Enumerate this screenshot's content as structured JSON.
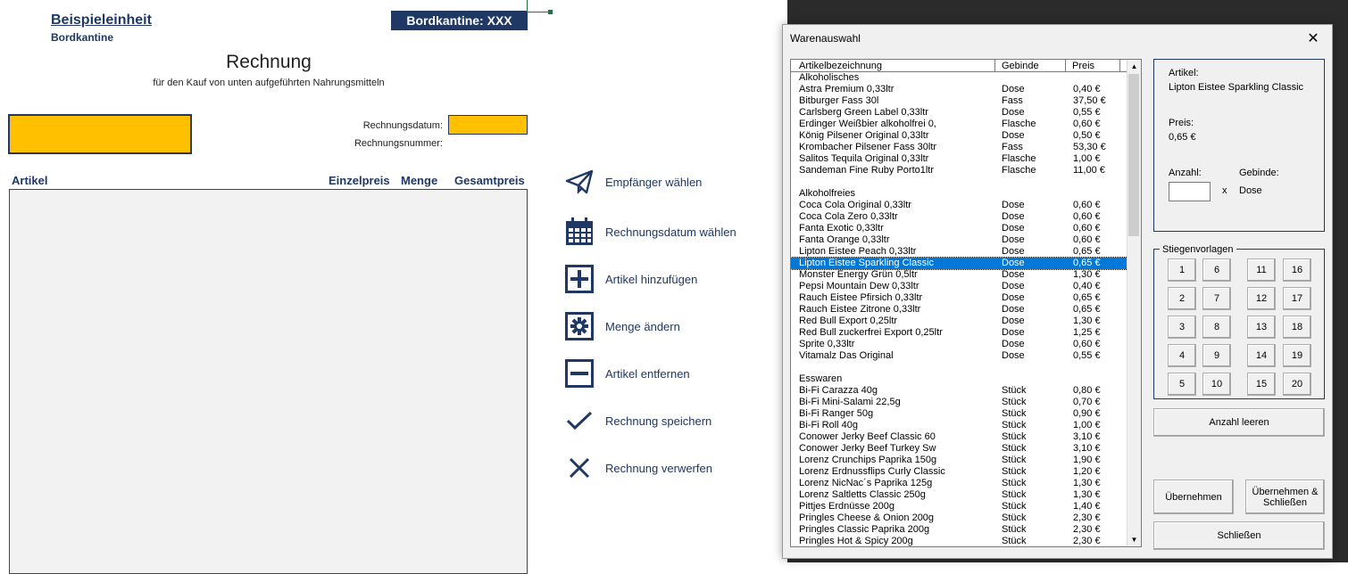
{
  "sheet": {
    "unit_name": "Beispieleinheit",
    "unit_sub": "Bordkantine",
    "kantine_label": "Bordkantine: XXX",
    "title": "Rechnung",
    "subtitle": "für den Kauf von unten aufgeführten Nahrungsmitteln",
    "date_label": "Rechnungsdatum:",
    "number_label": "Rechnungsnummer:",
    "columns": {
      "artikel": "Artikel",
      "einzelpreis": "Einzelpreis",
      "menge": "Menge",
      "gesamtpreis": "Gesamtpreis"
    },
    "highlight_color": "#ffc000",
    "brand_color": "#1f3864"
  },
  "actions": [
    {
      "icon": "paper-plane-icon",
      "label": "Empfänger wählen"
    },
    {
      "icon": "calendar-icon",
      "label": "Rechnungsdatum wählen"
    },
    {
      "icon": "plus-box-icon",
      "label": "Artikel hinzufügen"
    },
    {
      "icon": "gear-box-icon",
      "label": "Menge ändern"
    },
    {
      "icon": "minus-box-icon",
      "label": "Artikel entfernen"
    },
    {
      "icon": "checkmark-icon",
      "label": "Rechnung speichern"
    },
    {
      "icon": "x-mark-icon",
      "label": "Rechnung verwerfen"
    }
  ],
  "dialog": {
    "title": "Warenauswahl",
    "close": "✕",
    "list_headers": {
      "name": "Artikelbezeichnung",
      "gebinde": "Gebinde",
      "preis": "Preis"
    },
    "rows": [
      {
        "name": "Alkoholisches",
        "gebinde": "",
        "preis": "",
        "type": "category"
      },
      {
        "name": "Astra Premium 0,33ltr",
        "gebinde": "Dose",
        "preis": "0,40 €"
      },
      {
        "name": "Bitburger Fass 30l",
        "gebinde": "Fass",
        "preis": "37,50 €"
      },
      {
        "name": "Carlsberg Green Label 0,33ltr",
        "gebinde": "Dose",
        "preis": "0,55 €"
      },
      {
        "name": "Erdinger Weißbier alkoholfrei 0,",
        "gebinde": "Flasche",
        "preis": "0,60 €"
      },
      {
        "name": "König Pilsener Original 0,33ltr",
        "gebinde": "Dose",
        "preis": "0,50 €"
      },
      {
        "name": "Krombacher Pilsener Fass 30ltr",
        "gebinde": "Fass",
        "preis": "53,30 €"
      },
      {
        "name": "Salitos Tequila Original 0,33ltr",
        "gebinde": "Flasche",
        "preis": "1,00 €"
      },
      {
        "name": "Sandeman Fine Ruby Porto1ltr",
        "gebinde": "Flasche",
        "preis": "11,00 €"
      },
      {
        "name": "",
        "gebinde": "",
        "preis": "",
        "type": "blank"
      },
      {
        "name": "Alkoholfreies",
        "gebinde": "",
        "preis": "",
        "type": "category"
      },
      {
        "name": "Coca Cola Original 0,33ltr",
        "gebinde": "Dose",
        "preis": "0,60 €"
      },
      {
        "name": "Coca Cola Zero 0,33ltr",
        "gebinde": "Dose",
        "preis": "0,60 €"
      },
      {
        "name": "Fanta Exotic 0,33ltr",
        "gebinde": "Dose",
        "preis": "0,60 €"
      },
      {
        "name": "Fanta Orange 0,33ltr",
        "gebinde": "Dose",
        "preis": "0,60 €"
      },
      {
        "name": "Lipton Eistee Peach 0,33ltr",
        "gebinde": "Dose",
        "preis": "0,65 €"
      },
      {
        "name": "Lipton Eistee Sparkling Classic",
        "gebinde": "Dose",
        "preis": "0,65 €",
        "selected": true
      },
      {
        "name": "Monster Energy Grün 0,5ltr",
        "gebinde": "Dose",
        "preis": "1,30 €"
      },
      {
        "name": "Pepsi Mountain Dew 0,33ltr",
        "gebinde": "Dose",
        "preis": "0,40 €"
      },
      {
        "name": "Rauch Eistee Pfirsich 0,33ltr",
        "gebinde": "Dose",
        "preis": "0,65 €"
      },
      {
        "name": "Rauch Eistee Zitrone 0,33ltr",
        "gebinde": "Dose",
        "preis": "0,65 €"
      },
      {
        "name": "Red Bull Export 0,25ltr",
        "gebinde": "Dose",
        "preis": "1,30 €"
      },
      {
        "name": "Red Bull zuckerfrei Export 0,25ltr",
        "gebinde": "Dose",
        "preis": "1,25 €"
      },
      {
        "name": "Sprite 0,33ltr",
        "gebinde": "Dose",
        "preis": "0,60 €"
      },
      {
        "name": "Vitamalz Das Original",
        "gebinde": "Dose",
        "preis": "0,55 €"
      },
      {
        "name": "",
        "gebinde": "",
        "preis": "",
        "type": "blank"
      },
      {
        "name": "Esswaren",
        "gebinde": "",
        "preis": "",
        "type": "category"
      },
      {
        "name": "Bi-Fi Carazza 40g",
        "gebinde": "Stück",
        "preis": "0,80 €"
      },
      {
        "name": "Bi-Fi Mini-Salami 22,5g",
        "gebinde": "Stück",
        "preis": "0,70 €"
      },
      {
        "name": "Bi-Fi Ranger 50g",
        "gebinde": "Stück",
        "preis": "0,90 €"
      },
      {
        "name": "Bi-Fi Roll 40g",
        "gebinde": "Stück",
        "preis": "1,00 €"
      },
      {
        "name": "Conower Jerky Beef Classic 60",
        "gebinde": "Stück",
        "preis": "3,10 €"
      },
      {
        "name": "Conower Jerky Beef Turkey Sw",
        "gebinde": "Stück",
        "preis": "3,10 €"
      },
      {
        "name": "Lorenz Crunchips Paprika 150g",
        "gebinde": "Stück",
        "preis": "1,90 €"
      },
      {
        "name": "Lorenz Erdnussflips Curly Classic",
        "gebinde": "Stück",
        "preis": "1,20 €"
      },
      {
        "name": "Lorenz NicNac´s Paprika 125g",
        "gebinde": "Stück",
        "preis": "1,30 €"
      },
      {
        "name": "Lorenz Saltletts Classic 250g",
        "gebinde": "Stück",
        "preis": "1,30 €"
      },
      {
        "name": "Pittjes Erdnüsse 200g",
        "gebinde": "Stück",
        "preis": "1,40 €"
      },
      {
        "name": "Pringles Cheese & Onion 200g",
        "gebinde": "Stück",
        "preis": "2,30 €"
      },
      {
        "name": "Pringles Classic Paprika 200g",
        "gebinde": "Stück",
        "preis": "2,30 €"
      },
      {
        "name": "Pringles Hot & Spicy 200g",
        "gebinde": "Stück",
        "preis": "2,30 €"
      }
    ],
    "info": {
      "artikel_label": "Artikel:",
      "artikel_value": "Lipton Eistee Sparkling Classic",
      "preis_label": "Preis:",
      "preis_value": "0,65 €",
      "anzahl_label": "Anzahl:",
      "anzahl_value": "",
      "times": "x",
      "gebinde_label": "Gebinde:",
      "gebinde_value": "Dose"
    },
    "stiegen_title": "Stiegenvorlagen",
    "stiegen_buttons": [
      "1",
      "6",
      "11",
      "16",
      "2",
      "7",
      "12",
      "17",
      "3",
      "8",
      "13",
      "18",
      "4",
      "9",
      "14",
      "19",
      "5",
      "10",
      "15",
      "20"
    ],
    "buttons": {
      "clear": "Anzahl leeren",
      "apply": "Übernehmen",
      "apply_close": "Übernehmen & Schließen",
      "close": "Schließen"
    }
  }
}
